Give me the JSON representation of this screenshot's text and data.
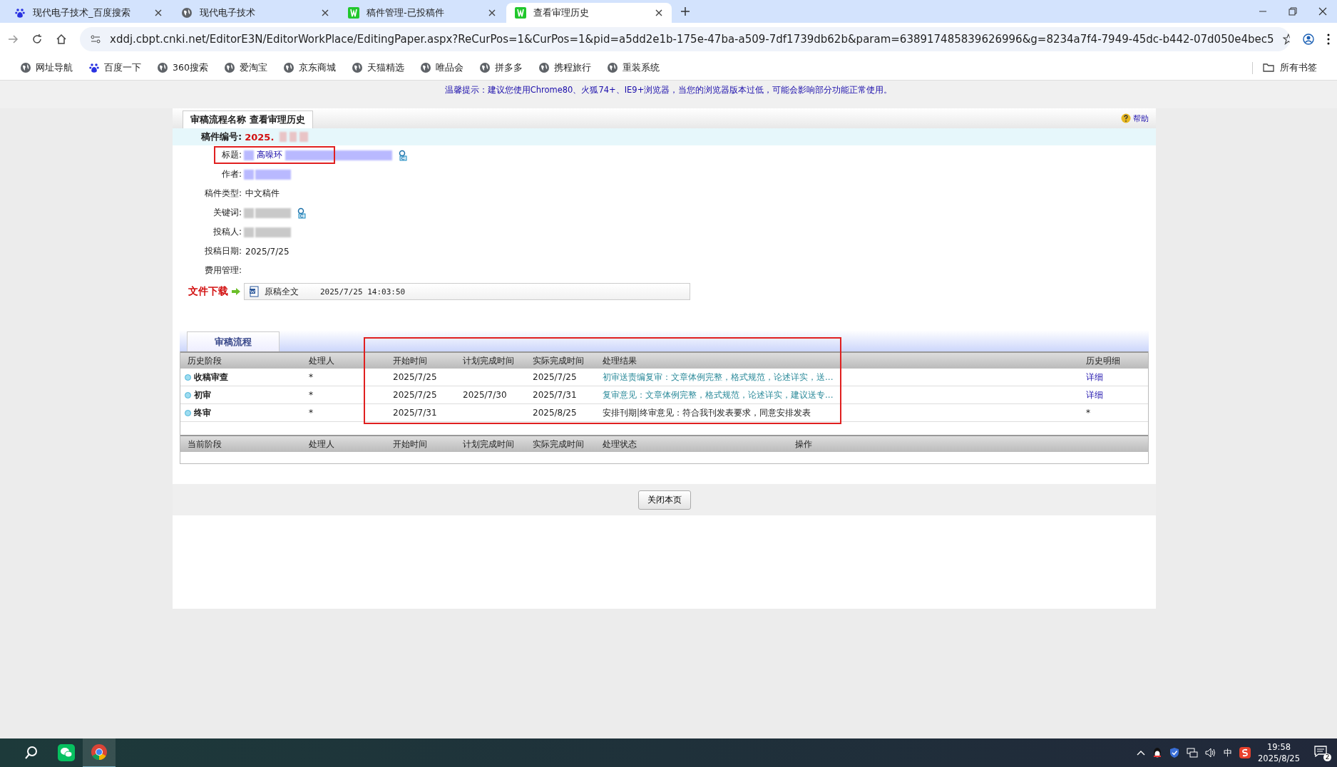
{
  "browser": {
    "tabs": [
      {
        "title": "现代电子技术_百度搜索",
        "selected": false
      },
      {
        "title": "现代电子技术",
        "selected": false
      },
      {
        "title": "稿件管理-已投稿件",
        "selected": false
      },
      {
        "title": "查看审理历史",
        "selected": true
      }
    ],
    "url": "xddj.cbpt.cnki.net/EditorE3N/EditorWorkPlace/EditingPaper.aspx?ReCurPos=1&CurPos=1&pid=a5dd2e1b-175e-47ba-a509-7df1739db62b&param=638917485839626996&g=8234a7f4-7949-45dc-b442-07d050e4bec5",
    "bookmarks": [
      "网址导航",
      "百度一下",
      "360搜索",
      "爱淘宝",
      "京东商城",
      "天猫精选",
      "唯品会",
      "拼多多",
      "携程旅行",
      "重装系统"
    ],
    "all_bookmarks": "所有书签"
  },
  "notice": "温馨提示：建议您使用Chrome80、火狐74+、IE9+浏览器，当您的浏览器版本过低，可能会影响部分功能正常使用。",
  "panel": {
    "title": "审稿流程名称 查看审理历史",
    "help": "帮助",
    "manuscript_no": {
      "label": "稿件编号:",
      "value": "2025."
    },
    "fields": [
      {
        "label": "标题:",
        "value": "高噪环",
        "kind": "link",
        "blurred": true,
        "search_icon": true,
        "highlighted": true
      },
      {
        "label": "作者:",
        "kind": "link",
        "blurred": true,
        "search_icon": false,
        "highlighted": false
      },
      {
        "label": "稿件类型:",
        "value": "中文稿件",
        "kind": "text",
        "blurred": false,
        "search_icon": false,
        "highlighted": false
      },
      {
        "label": "关键词:",
        "kind": "text",
        "blurred": true,
        "search_icon": true,
        "highlighted": false
      },
      {
        "label": "投稿人:",
        "kind": "text",
        "blurred": true,
        "search_icon": false,
        "highlighted": false
      },
      {
        "label": "投稿日期:",
        "value": "2025/7/25",
        "kind": "text",
        "blurred": false,
        "search_icon": false,
        "highlighted": false
      },
      {
        "label": "费用管理:",
        "kind": "text",
        "blurred": false,
        "search_icon": false,
        "highlighted": false
      }
    ],
    "download": {
      "label": "文件下载",
      "file": "原稿全文",
      "time": "2025/7/25 14:03:50"
    },
    "section_tab": "审稿流程",
    "history": {
      "highlighted": true,
      "columns": [
        "历史阶段",
        "处理人",
        "开始时间",
        "计划完成时间",
        "实际完成时间",
        "处理结果",
        "历史明细"
      ],
      "rows": [
        {
          "stage": "收稿审查",
          "handler": "*",
          "start": "2025/7/25",
          "planned": "",
          "actual": "2025/7/25",
          "result": "初审送责编复审：文章体例完整，格式规范，论述详实，送...",
          "detail": "详细",
          "linked": true
        },
        {
          "stage": "初审",
          "handler": "*",
          "start": "2025/7/25",
          "planned": "2025/7/30",
          "actual": "2025/7/31",
          "result": "复审意见：文章体例完整，格式规范，论述详实，建议送专...",
          "detail": "详细",
          "linked": true
        },
        {
          "stage": "终审",
          "handler": "*",
          "start": "2025/7/31",
          "planned": "",
          "actual": "2025/8/25",
          "result": "安排刊期|终审意见：符合我刊发表要求，同意安排发表",
          "detail": "*",
          "linked": false
        }
      ]
    },
    "current": {
      "columns": [
        "当前阶段",
        "处理人",
        "开始时间",
        "计划完成时间",
        "实际完成时间",
        "处理状态",
        "操作"
      ]
    },
    "close_button": "关闭本页"
  },
  "taskbar": {
    "ime": "中",
    "time": "19:58",
    "date": "2025/8/25",
    "notifications": "2"
  }
}
